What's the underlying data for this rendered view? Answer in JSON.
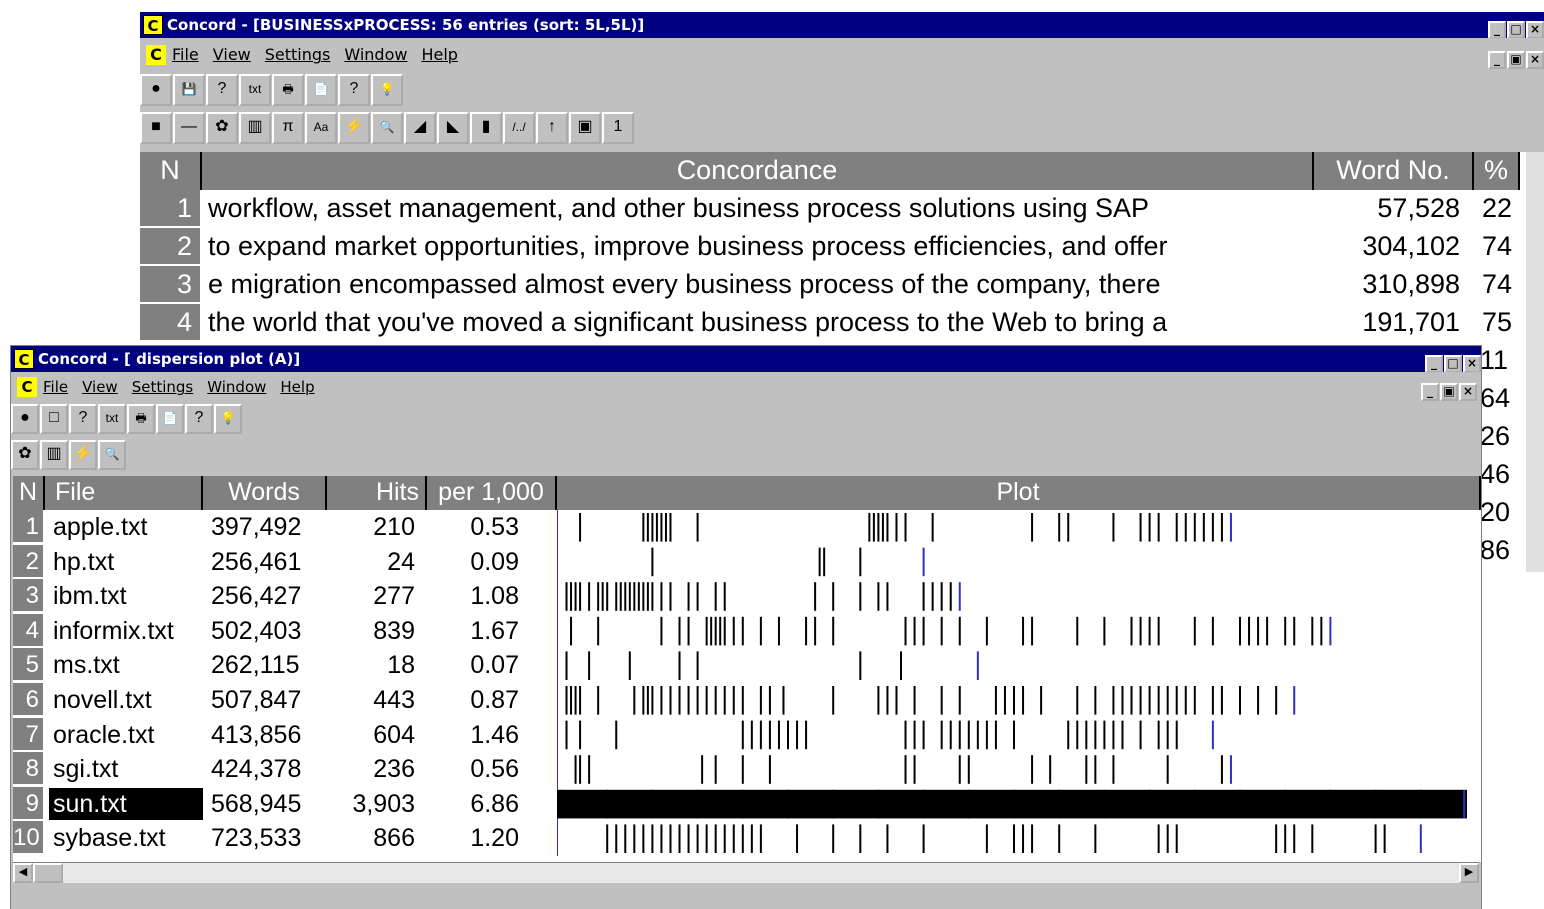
{
  "concordance_window": {
    "title": "Concord - [BUSINESSxPROCESS: 56 entries (sort: 5L,5L)]",
    "menu": [
      "File",
      "View",
      "Settings",
      "Window",
      "Help"
    ],
    "toolbar1_icons": [
      "go-icon",
      "save-icon",
      "save-as-icon",
      "txt-icon",
      "print-icon",
      "print-preview-icon",
      "help-icon",
      "tip-icon"
    ],
    "toolbar1_labels": [
      "●",
      "💾",
      "?",
      "txt",
      "🖶",
      "📄",
      "?",
      "💡"
    ],
    "toolbar2_icons": [
      "color-icon",
      "line-icon",
      "settings-icon",
      "columns-icon",
      "pi-icon",
      "font-icon",
      "zap-icon",
      "search-icon",
      "sort-left-icon",
      "sort-right-icon",
      "barcode-icon",
      "pattern-icon",
      "up-arrow-icon",
      "clipboard-icon",
      "number-icon"
    ],
    "toolbar2_labels": [
      "■",
      "—",
      "✿",
      "▥",
      "π",
      "Aa",
      "⚡",
      "🔍",
      "◢",
      "◣",
      "▮",
      "/../",
      "↑",
      "▣",
      "1"
    ],
    "headers": {
      "n": "N",
      "concordance": "Concordance",
      "word_no": "Word No.",
      "percent": "%"
    },
    "rows": [
      {
        "n": "1",
        "text": " workflow, asset management, and other business process solutions using SAP",
        "word_no": "57,528",
        "pct": "22"
      },
      {
        "n": "2",
        "text": "to expand market opportunities, improve business process efficiencies, and offer",
        "word_no": "304,102",
        "pct": "74"
      },
      {
        "n": "3",
        "text": " e migration encompassed almost every business process of the company, there",
        "word_no": "310,898",
        "pct": "74"
      },
      {
        "n": "4",
        "text": "the world that you've moved a significant business process to the Web to bring a",
        "word_no": "191,701",
        "pct": "75"
      }
    ],
    "hidden_pct": [
      "11",
      "64",
      "26",
      "46",
      "20",
      "86"
    ]
  },
  "dispersion_window": {
    "title": "Concord - [ dispersion plot (A)]",
    "menu": [
      "File",
      "View",
      "Settings",
      "Window",
      "Help"
    ],
    "toolbar1_icons": [
      "go-icon",
      "save-icon",
      "help-book-icon",
      "txt-icon",
      "print-icon",
      "print-preview-icon",
      "help-icon",
      "tip-icon"
    ],
    "toolbar1_labels": [
      "●",
      "□",
      "?",
      "txt",
      "🖶",
      "📄",
      "?",
      "💡"
    ],
    "toolbar2_icons": [
      "settings-icon",
      "columns-icon",
      "zap-icon",
      "search-icon"
    ],
    "toolbar2_labels": [
      "✿",
      "▥",
      "⚡",
      "🔍"
    ],
    "headers": {
      "n": "N",
      "file": "File",
      "words": "Words",
      "hits": "Hits",
      "per": "per 1,000",
      "plot": "Plot"
    },
    "rows": [
      {
        "n": "1",
        "file": "apple.txt",
        "words": "397,492",
        "hits": "210",
        "per": "0.53"
      },
      {
        "n": "2",
        "file": "hp.txt",
        "words": "256,461",
        "hits": "24",
        "per": "0.09"
      },
      {
        "n": "3",
        "file": "ibm.txt",
        "words": "256,427",
        "hits": "277",
        "per": "1.08"
      },
      {
        "n": "4",
        "file": "informix.txt",
        "words": "502,403",
        "hits": "839",
        "per": "1.67"
      },
      {
        "n": "5",
        "file": "ms.txt",
        "words": "262,115",
        "hits": "18",
        "per": "0.07"
      },
      {
        "n": "6",
        "file": "novell.txt",
        "words": "507,847",
        "hits": "443",
        "per": "0.87"
      },
      {
        "n": "7",
        "file": "oracle.txt",
        "words": "413,856",
        "hits": "604",
        "per": "1.46"
      },
      {
        "n": "8",
        "file": "sgi.txt",
        "words": "424,378",
        "hits": "236",
        "per": "0.56"
      },
      {
        "n": "9",
        "file": "sun.txt",
        "words": "568,945",
        "hits": "3,903",
        "per": "6.86"
      },
      {
        "n": "10",
        "file": "sybase.txt",
        "words": "723,533",
        "hits": "866",
        "per": "1.20"
      }
    ],
    "plot_marks": [
      [
        0.02,
        0.09,
        0.095,
        0.1,
        0.105,
        0.11,
        0.115,
        0.12,
        0.15,
        0.34,
        0.345,
        0.35,
        0.355,
        0.36,
        0.37,
        0.38,
        0.41,
        0.52,
        0.55,
        0.56,
        0.61,
        0.64,
        0.65,
        0.66,
        0.68,
        0.69,
        0.7,
        0.71,
        0.72,
        0.73,
        0.74
      ],
      [
        0.1,
        0.285,
        0.29,
        0.33,
        0.4
      ],
      [
        0.005,
        0.01,
        0.015,
        0.02,
        0.03,
        0.04,
        0.045,
        0.05,
        0.06,
        0.065,
        0.07,
        0.075,
        0.08,
        0.085,
        0.09,
        0.095,
        0.1,
        0.11,
        0.12,
        0.14,
        0.15,
        0.17,
        0.18,
        0.28,
        0.3,
        0.33,
        0.35,
        0.36,
        0.4,
        0.41,
        0.42,
        0.43,
        0.44
      ],
      [
        0.01,
        0.04,
        0.11,
        0.13,
        0.14,
        0.16,
        0.165,
        0.17,
        0.175,
        0.18,
        0.19,
        0.2,
        0.22,
        0.24,
        0.27,
        0.28,
        0.3,
        0.38,
        0.39,
        0.4,
        0.42,
        0.44,
        0.47,
        0.51,
        0.52,
        0.57,
        0.6,
        0.63,
        0.64,
        0.65,
        0.66,
        0.7,
        0.72,
        0.75,
        0.76,
        0.77,
        0.78,
        0.8,
        0.81,
        0.83,
        0.84,
        0.85
      ],
      [
        0.005,
        0.03,
        0.075,
        0.13,
        0.15,
        0.33,
        0.375,
        0.46
      ],
      [
        0.005,
        0.01,
        0.015,
        0.02,
        0.04,
        0.08,
        0.09,
        0.095,
        0.1,
        0.11,
        0.12,
        0.13,
        0.14,
        0.15,
        0.16,
        0.17,
        0.18,
        0.19,
        0.2,
        0.22,
        0.23,
        0.245,
        0.3,
        0.35,
        0.36,
        0.37,
        0.39,
        0.42,
        0.44,
        0.48,
        0.49,
        0.5,
        0.51,
        0.53,
        0.57,
        0.59,
        0.61,
        0.62,
        0.63,
        0.64,
        0.65,
        0.66,
        0.67,
        0.68,
        0.69,
        0.7,
        0.72,
        0.73,
        0.75,
        0.77,
        0.79,
        0.81
      ],
      [
        0.005,
        0.02,
        0.06,
        0.2,
        0.21,
        0.22,
        0.23,
        0.24,
        0.25,
        0.26,
        0.27,
        0.38,
        0.39,
        0.4,
        0.42,
        0.43,
        0.44,
        0.45,
        0.46,
        0.47,
        0.48,
        0.5,
        0.56,
        0.57,
        0.58,
        0.59,
        0.6,
        0.61,
        0.62,
        0.64,
        0.66,
        0.67,
        0.68,
        0.72
      ],
      [
        0.015,
        0.02,
        0.03,
        0.155,
        0.17,
        0.2,
        0.23,
        0.38,
        0.39,
        0.44,
        0.45,
        0.52,
        0.54,
        0.58,
        0.59,
        0.61,
        0.67,
        0.73,
        0.74
      ],
      [
        0.0,
        0.05,
        0.1,
        0.15,
        0.2,
        0.25,
        0.3,
        0.35,
        0.4,
        0.45,
        0.5,
        0.55,
        0.6,
        0.65,
        0.7,
        0.75,
        0.8,
        0.85,
        0.9,
        0.95,
        0.998
      ],
      [
        0.05,
        0.06,
        0.07,
        0.08,
        0.09,
        0.1,
        0.11,
        0.12,
        0.13,
        0.14,
        0.15,
        0.16,
        0.17,
        0.18,
        0.19,
        0.2,
        0.21,
        0.22,
        0.26,
        0.3,
        0.33,
        0.36,
        0.4,
        0.47,
        0.5,
        0.51,
        0.52,
        0.55,
        0.59,
        0.66,
        0.67,
        0.68,
        0.79,
        0.8,
        0.81,
        0.83,
        0.9,
        0.91,
        0.95
      ]
    ],
    "solid_rows": [
      8
    ]
  }
}
